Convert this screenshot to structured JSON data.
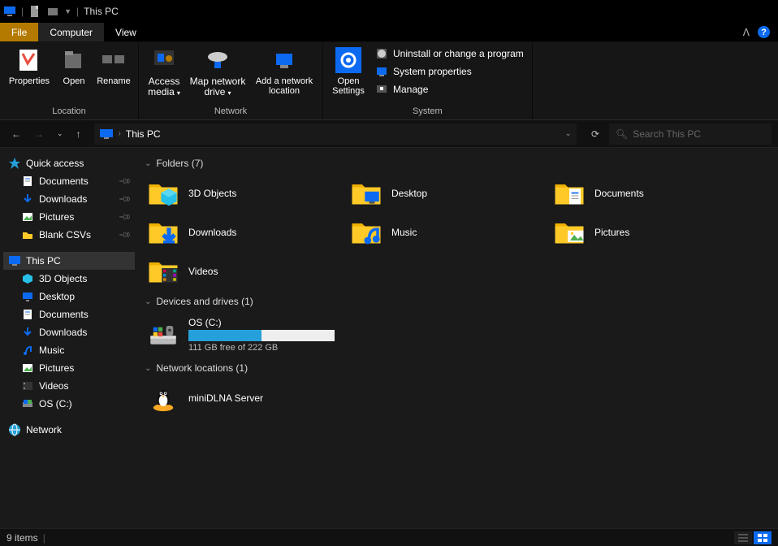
{
  "window": {
    "title": "This PC"
  },
  "tabs": {
    "file": "File",
    "computer": "Computer",
    "view": "View"
  },
  "ribbon": {
    "location": {
      "label": "Location",
      "properties": "Properties",
      "open": "Open",
      "rename": "Rename"
    },
    "network": {
      "label": "Network",
      "access_media": "Access media",
      "map_drive": "Map network drive",
      "add_netloc": "Add a network location"
    },
    "settings": {
      "open_settings": "Open Settings"
    },
    "system": {
      "label": "System",
      "uninstall": "Uninstall or change a program",
      "sysprops": "System properties",
      "manage": "Manage"
    }
  },
  "address": {
    "path": "This PC"
  },
  "search": {
    "placeholder": "Search This PC"
  },
  "sidebar": {
    "quick_access": "Quick access",
    "pinned": [
      {
        "label": "Documents"
      },
      {
        "label": "Downloads"
      },
      {
        "label": "Pictures"
      },
      {
        "label": "Blank CSVs"
      }
    ],
    "this_pc": "This PC",
    "pc_children": [
      {
        "label": "3D Objects"
      },
      {
        "label": "Desktop"
      },
      {
        "label": "Documents"
      },
      {
        "label": "Downloads"
      },
      {
        "label": "Music"
      },
      {
        "label": "Pictures"
      },
      {
        "label": "Videos"
      },
      {
        "label": "OS (C:)"
      }
    ],
    "network": "Network"
  },
  "sections": {
    "folders": {
      "title": "Folders (7)",
      "items": [
        {
          "label": "3D Objects",
          "kind": "3d"
        },
        {
          "label": "Desktop",
          "kind": "desktop"
        },
        {
          "label": "Documents",
          "kind": "documents"
        },
        {
          "label": "Downloads",
          "kind": "downloads"
        },
        {
          "label": "Music",
          "kind": "music"
        },
        {
          "label": "Pictures",
          "kind": "pictures"
        },
        {
          "label": "Videos",
          "kind": "videos"
        }
      ]
    },
    "drives": {
      "title": "Devices and drives (1)",
      "items": [
        {
          "label": "OS (C:)",
          "free_text": "111 GB free of 222 GB",
          "fill_pct": 50
        }
      ]
    },
    "netloc": {
      "title": "Network locations (1)",
      "items": [
        {
          "label": "miniDLNA Server"
        }
      ]
    }
  },
  "statusbar": {
    "text": "9 items"
  }
}
